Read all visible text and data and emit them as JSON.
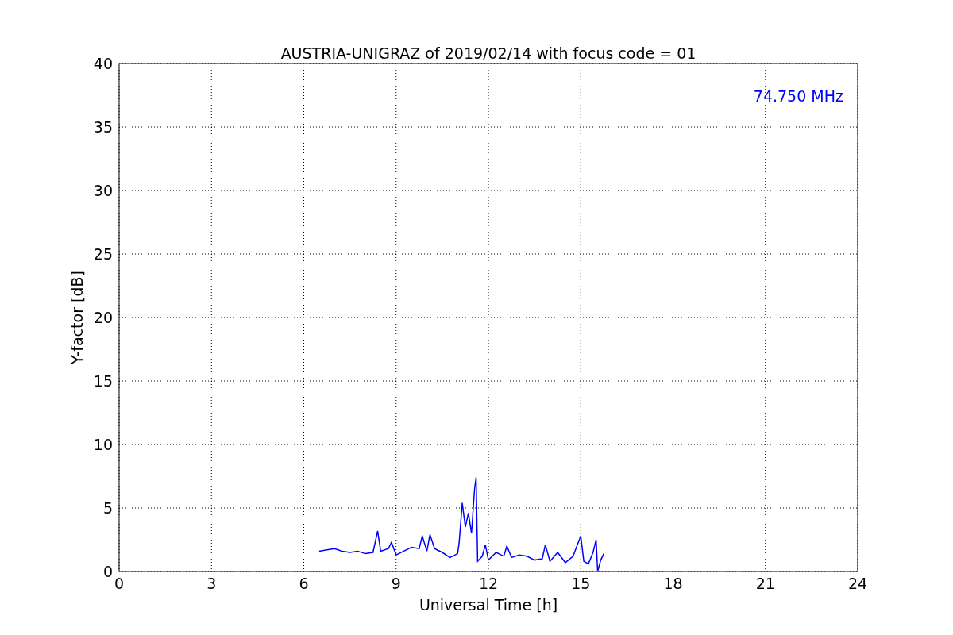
{
  "figure": {
    "chart_data": {
      "type": "line",
      "title": "AUSTRIA-UNIGRAZ of 2019/02/14 with focus code = 01",
      "xlabel": "Universal Time [h]",
      "ylabel": "Y-factor [dB]",
      "x": [
        6.5,
        6.75,
        7.0,
        7.25,
        7.5,
        7.75,
        8.0,
        8.25,
        8.4,
        8.5,
        8.75,
        8.85,
        9.0,
        9.25,
        9.5,
        9.75,
        9.85,
        10.0,
        10.1,
        10.25,
        10.5,
        10.75,
        11.0,
        11.05,
        11.15,
        11.25,
        11.35,
        11.45,
        11.55,
        11.6,
        11.65,
        11.8,
        11.9,
        12.0,
        12.25,
        12.5,
        12.6,
        12.75,
        13.0,
        13.25,
        13.5,
        13.75,
        13.85,
        14.0,
        14.25,
        14.5,
        14.75,
        15.0,
        15.1,
        15.25,
        15.4,
        15.5,
        15.55,
        15.65,
        15.75
      ],
      "series": [
        {
          "name": "74.750 MHz",
          "color": "#0000ff",
          "values": [
            1.6,
            1.7,
            1.8,
            1.6,
            1.5,
            1.6,
            1.4,
            1.5,
            3.2,
            1.6,
            1.8,
            2.3,
            1.3,
            1.6,
            1.9,
            1.8,
            2.8,
            1.6,
            2.9,
            1.8,
            1.5,
            1.1,
            1.4,
            2.3,
            5.4,
            3.5,
            4.6,
            3.0,
            6.5,
            7.4,
            0.8,
            1.2,
            2.1,
            0.9,
            1.5,
            1.2,
            2.0,
            1.1,
            1.3,
            1.2,
            0.9,
            1.0,
            2.1,
            0.8,
            1.5,
            0.7,
            1.2,
            2.8,
            0.8,
            0.6,
            1.5,
            2.5,
            0.0,
            0.9,
            1.4
          ]
        }
      ],
      "xlim": [
        0,
        24
      ],
      "ylim": [
        0,
        40
      ],
      "xticks": [
        0,
        3,
        6,
        9,
        12,
        15,
        18,
        21,
        24
      ],
      "yticks": [
        0,
        5,
        10,
        15,
        20,
        25,
        30,
        35,
        40
      ],
      "grid": true
    }
  }
}
